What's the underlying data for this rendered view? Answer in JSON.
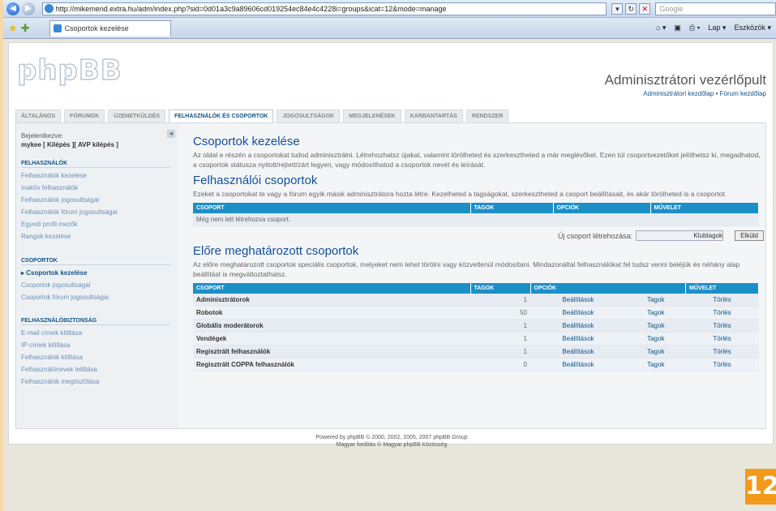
{
  "browser": {
    "url": "http://mikemend.extra.hu/adm/index.php?sid=0d01a3c9a89606cd019254ec84e4c4228i=groups&icat=12&mode=manage",
    "search_placeholder": "Google",
    "tab_title": "Csoportok kezelése",
    "tools": [
      "Lap ▾",
      "Eszközök ▾"
    ]
  },
  "header": {
    "logo": "phpBB",
    "title": "Adminisztrátori vezérlőpult",
    "links": "Adminisztrátori kezdőlap • Fórum kezdőlap"
  },
  "tabs": [
    "ÁLTALÁNOS",
    "FÓRUMOK",
    "ÜZENETKÜLDÉS",
    "FELHASZNÁLÓK ÉS CSOPORTOK",
    "JOGOSULTSÁGOK",
    "MEGJELENÉSEK",
    "KARBANTARTÁS",
    "RENDSZER"
  ],
  "sidebar": {
    "login_label": "Bejelentkezve:",
    "login_user": "mykee [ Kilépés ][ AVP kilépés ]",
    "sections": [
      {
        "title": "FELHASZNÁLÓK",
        "items": [
          "Felhasználók kezelése",
          "Inaktív felhasználók",
          "Felhasználók jogosultságai",
          "Felhasználók fórum jogosultságai",
          "Egyedi profil mezők",
          "Rangok kezelése"
        ]
      },
      {
        "title": "CSOPORTOK",
        "items": [
          "Csoportok kezelése",
          "Csoportok jogosultságai",
          "Csoportok fórum jogosultságai"
        ]
      },
      {
        "title": "FELHASZNÁLÓBIZTONSÁG",
        "items": [
          "E-mail címek kitiltása",
          "IP-címek kitiltása",
          "Felhasználók kitiltása",
          "Felhasználónevek letiltása",
          "Felhasználók megtisztítása"
        ]
      }
    ]
  },
  "main": {
    "title": "Csoportok kezelése",
    "intro": "Az oldal e részén a csoportokat tudod adminisztrálni. Létrehozhatsz újakat, valamint törölheted és szerkesztheted a már meglévőket. Ezen túl csoportvezetőket jelölhetsz ki, megadhatod, a csoportok státusza nyitott/rejtett/zárt legyen, vagy módosíthatod a csoportok nevét és leírását.",
    "user_groups_title": "Felhasználói csoportok",
    "user_groups_desc": "Ezeket a csoportokat te vagy a fórum egyik másik adminisztrátora hozta létre. Kezelheted a tagságokat, szerkesztheted a csoport beállításait, és akár törölheted is a csoportot.",
    "columns": [
      "CSOPORT",
      "TAGOK",
      "OPCIÓK",
      "MŰVELET"
    ],
    "empty_text": "Még nem lett létrehozva csoport.",
    "new_group_label": "Új csoport létrehozása:",
    "new_group_value": "Klubtagok",
    "submit_label": "Elküld",
    "predefined_title": "Előre meghatározott csoportok",
    "predefined_desc": "Az előre meghatározott csoportok speciális csoportok, melyeket nem lehet törölni vagy közvetlenül módosítani. Mindazonáltal felhasználókat fel tudsz venni beléjük és néhány alap beállítást is megváltoztathatsz.",
    "groups": [
      {
        "name": "Adminisztrátorok",
        "members": "1",
        "settings": "Beállítások",
        "membersLink": "Tagok",
        "action": "Törlés"
      },
      {
        "name": "Robotok",
        "members": "50",
        "settings": "Beállítások",
        "membersLink": "Tagok",
        "action": "Törlés"
      },
      {
        "name": "Globális moderátorok",
        "members": "1",
        "settings": "Beállítások",
        "membersLink": "Tagok",
        "action": "Törlés"
      },
      {
        "name": "Vendégek",
        "members": "1",
        "settings": "Beállítások",
        "membersLink": "Tagok",
        "action": "Törlés"
      },
      {
        "name": "Regisztrált felhasználók",
        "members": "1",
        "settings": "Beállítások",
        "membersLink": "Tagok",
        "action": "Törlés"
      },
      {
        "name": "Regisztrált COPPA felhasználók",
        "members": "0",
        "settings": "Beállítások",
        "membersLink": "Tagok",
        "action": "Törlés"
      }
    ]
  },
  "footer": {
    "line1": "Powered by phpBB © 2000, 2002, 2005, 2007 phpBB Group",
    "line2": "Magyar fordítás © Magyar phpBB Közösség"
  },
  "page_badge": "12"
}
